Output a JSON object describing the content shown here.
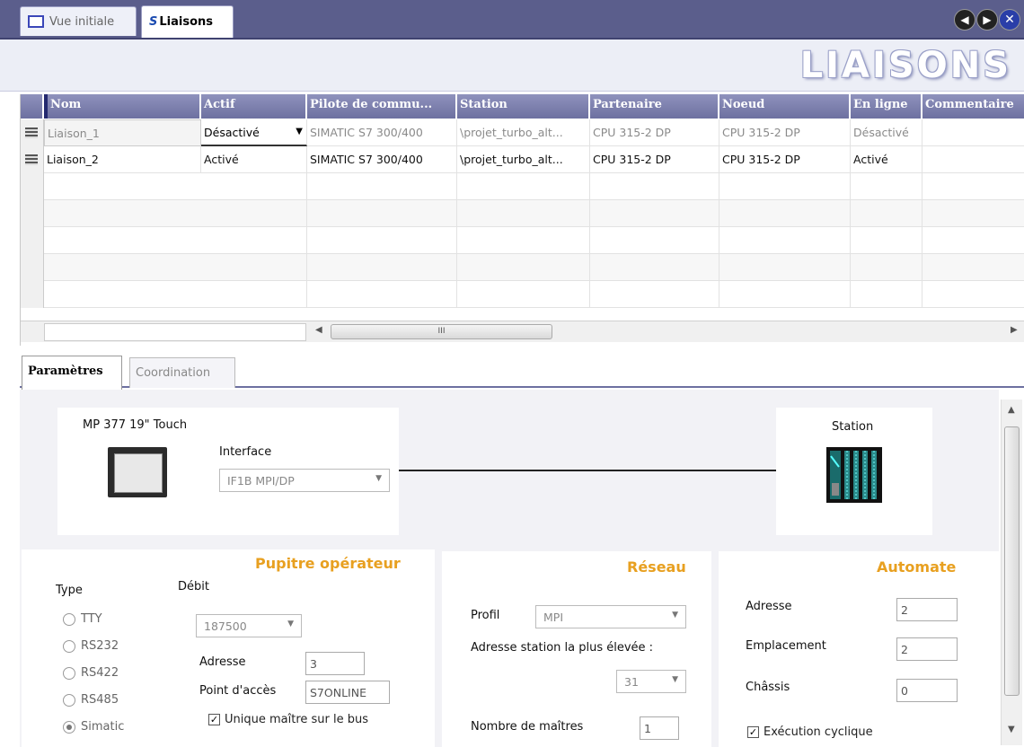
{
  "tabs": [
    {
      "label": "Vue initiale",
      "active": false
    },
    {
      "label": "Liaisons",
      "active": true
    }
  ],
  "nav": {
    "prev_icon": "left-arrow-icon",
    "next_icon": "right-arrow-icon",
    "close_icon": "close-icon"
  },
  "banner": {
    "title": "LIAISONS"
  },
  "table": {
    "columns": [
      "Nom",
      "Actif",
      "Pilote de commu...",
      "Station",
      "Partenaire",
      "Noeud",
      "En ligne",
      "Commentaire"
    ],
    "rows": [
      {
        "nom": "Liaison_1",
        "actif": "Désactivé",
        "pilote": "SIMATIC S7 300/400",
        "station": "\\projet_turbo_alt...",
        "partenaire": "CPU 315-2 DP",
        "noeud": "CPU 315-2 DP",
        "en_ligne": "Désactivé",
        "commentaire": "",
        "disabled": true
      },
      {
        "nom": "Liaison_2",
        "actif": "Activé",
        "pilote": "SIMATIC S7 300/400",
        "station": "\\projet_turbo_alt...",
        "partenaire": "CPU 315-2 DP",
        "noeud": "CPU 315-2 DP",
        "en_ligne": "Activé",
        "commentaire": "",
        "disabled": false
      }
    ],
    "scroll_thumb_label": "III"
  },
  "subtabs": {
    "parametres": "Paramètres",
    "coordination": "Coordination"
  },
  "diagram": {
    "hmi_label": "MP 377 19\" Touch",
    "interface_label": "Interface",
    "interface_value": "IF1B MPI/DP",
    "station_label": "Station"
  },
  "operator": {
    "heading": "Pupitre opérateur",
    "type_label": "Type",
    "debit_label": "Débit",
    "debit_value": "187500",
    "types": [
      {
        "label": "TTY",
        "selected": false
      },
      {
        "label": "RS232",
        "selected": false
      },
      {
        "label": "RS422",
        "selected": false
      },
      {
        "label": "RS485",
        "selected": false
      },
      {
        "label": "Simatic",
        "selected": true
      }
    ],
    "adresse_label": "Adresse",
    "adresse_value": "3",
    "point_acces_label": "Point d'accès",
    "point_acces_value": "S7ONLINE",
    "unique_maitre_label": "Unique maître sur le bus",
    "unique_maitre_checked": true
  },
  "network": {
    "heading": "Réseau",
    "profil_label": "Profil",
    "profil_value": "MPI",
    "adresse_max_label": "Adresse station la plus élevée :",
    "adresse_max_value": "31",
    "nb_maitres_label": "Nombre de maîtres",
    "nb_maitres_value": "1"
  },
  "automate": {
    "heading": "Automate",
    "adresse_label": "Adresse",
    "adresse_value": "2",
    "emplacement_label": "Emplacement",
    "emplacement_value": "2",
    "chassis_label": "Châssis",
    "chassis_value": "0",
    "cyclique_label": "Exécution cyclique",
    "cyclique_checked": true
  },
  "colors": {
    "header": "#6d70a0",
    "accent_orange": "#e8a020",
    "topbar": "#5b5e8c"
  }
}
